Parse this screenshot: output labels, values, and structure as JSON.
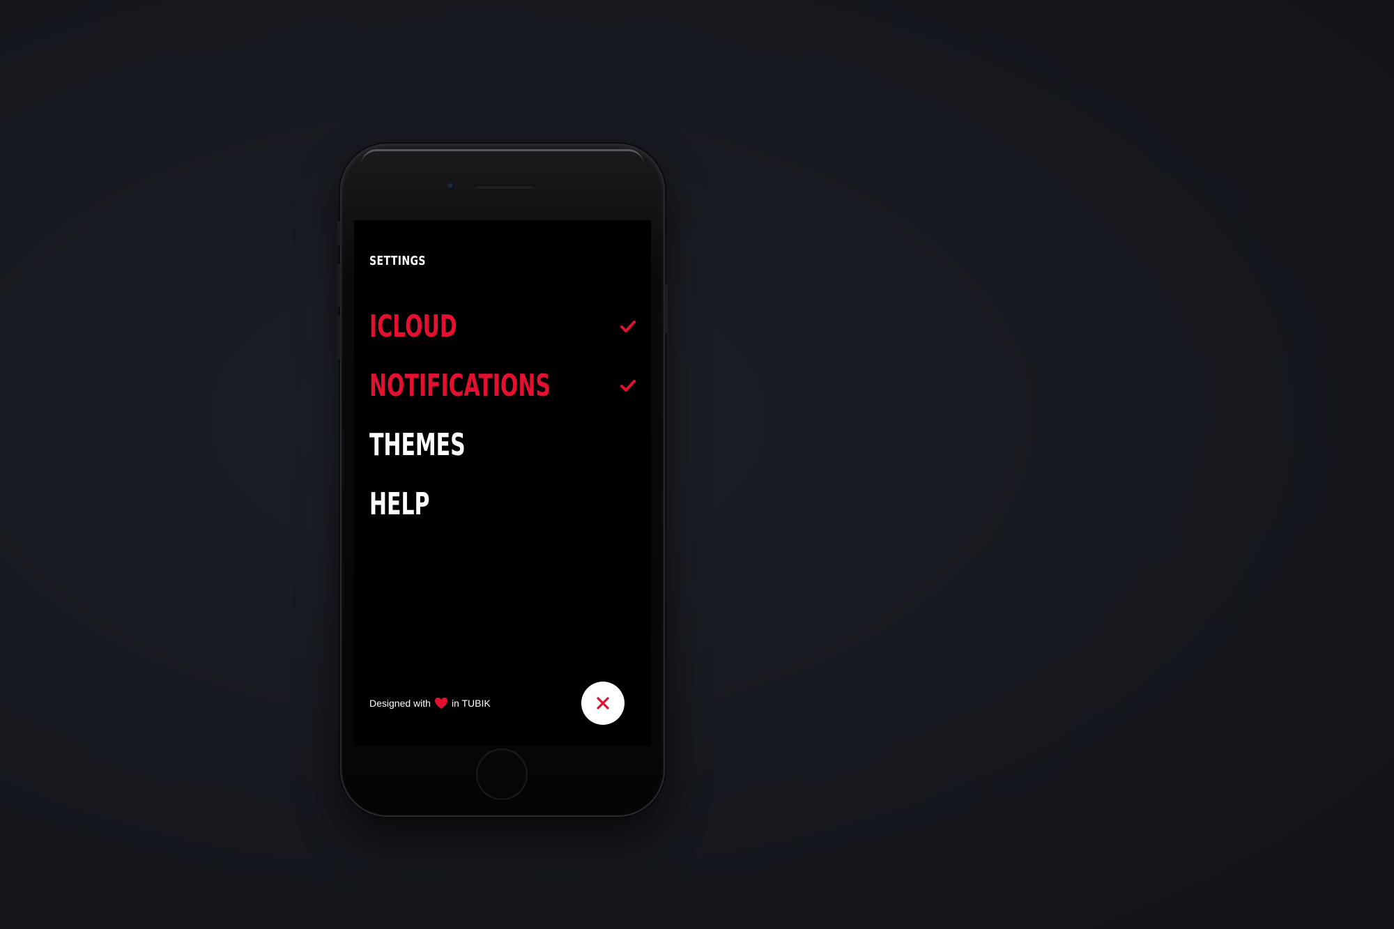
{
  "screen": {
    "title": "SETTINGS",
    "menu": [
      {
        "label": "ICLOUD",
        "checked": true
      },
      {
        "label": "NOTIFICATIONS",
        "checked": true
      },
      {
        "label": "THEMES",
        "checked": false
      },
      {
        "label": "HELP",
        "checked": false
      }
    ],
    "footer": {
      "prefix": "Designed with",
      "suffix": "in TUBIK",
      "heart_icon": "heart-icon"
    },
    "close_icon": "close-icon"
  },
  "colors": {
    "accent": "#e3102f",
    "screen_bg": "#000000",
    "text": "#ffffff",
    "backdrop": "#14161c"
  }
}
